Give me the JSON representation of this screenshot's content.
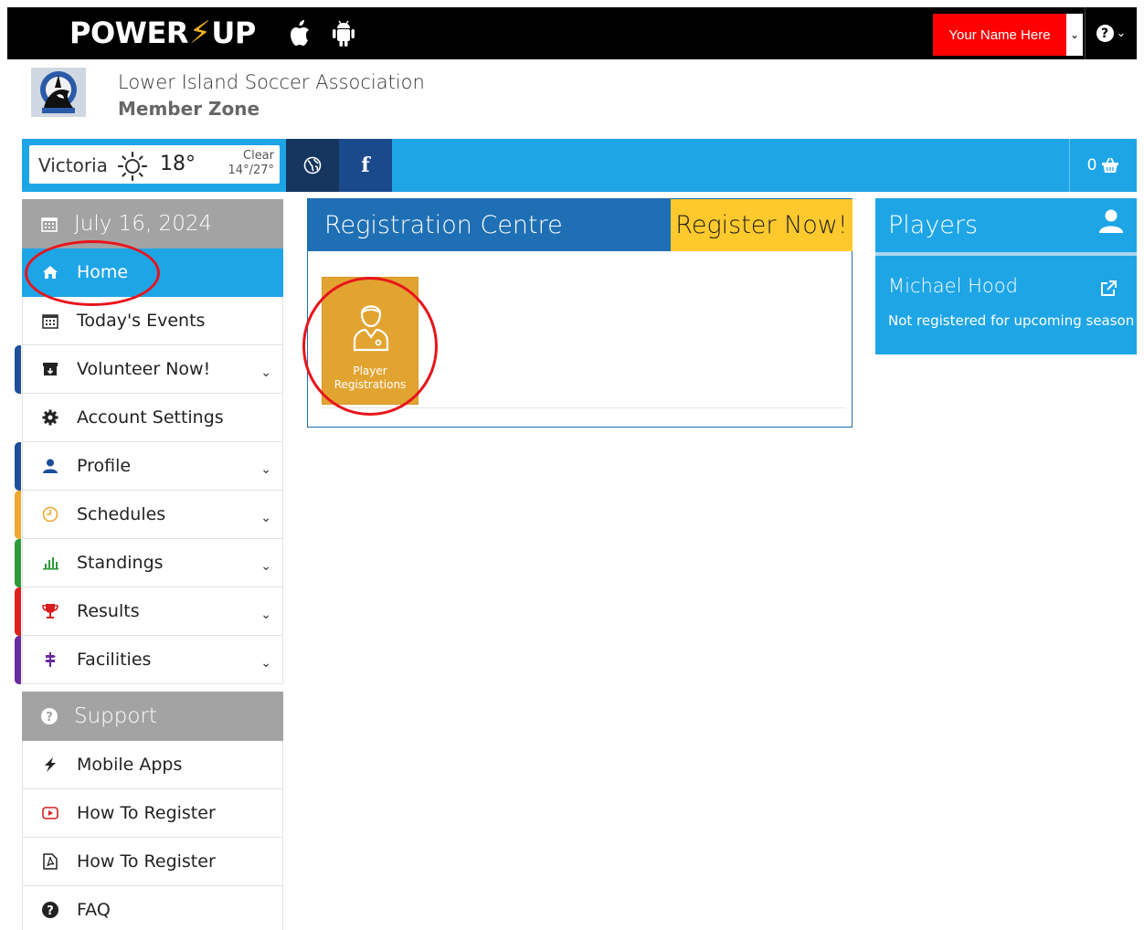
{
  "topbar": {
    "brand_left": "POWER",
    "brand_bolt": "⚡",
    "brand_right": "UP",
    "user_button": "Your Name Here",
    "user_caret": "⌄",
    "help_icon": "?",
    "help_caret": "⌄"
  },
  "header": {
    "org_name": "Lower Island Soccer Association",
    "zone_name": "Member Zone"
  },
  "weather": {
    "city": "Victoria",
    "temp": "18°",
    "condition": "Clear",
    "range": "14°/27°"
  },
  "social": {
    "facebook": "f"
  },
  "cart": {
    "count": "0"
  },
  "sidebar": {
    "date": "July 16, 2024",
    "items": [
      {
        "label": "Home",
        "icon": "home-icon"
      },
      {
        "label": "Today's Events",
        "icon": "calendar-icon"
      },
      {
        "label": "Volunteer Now!",
        "icon": "archive-icon",
        "stripe": "#1c4e9a"
      },
      {
        "label": "Account Settings",
        "icon": "gear-icon"
      },
      {
        "label": "Profile",
        "icon": "user-icon",
        "stripe": "#1c4e9a"
      },
      {
        "label": "Schedules",
        "icon": "clock-icon",
        "stripe": "#f0a830"
      },
      {
        "label": "Standings",
        "icon": "bar-chart-icon",
        "stripe": "#2e9a3a"
      },
      {
        "label": "Results",
        "icon": "trophy-icon",
        "stripe": "#e02020"
      },
      {
        "label": "Facilities",
        "icon": "signpost-icon",
        "stripe": "#6a2aa0"
      }
    ],
    "support_title": "Support",
    "support_items": [
      {
        "label": "Mobile Apps",
        "icon": "bolt-icon"
      },
      {
        "label": "How To Register",
        "icon": "video-icon"
      },
      {
        "label": "How To Register",
        "icon": "pdf-icon"
      },
      {
        "label": "FAQ",
        "icon": "question-icon"
      }
    ]
  },
  "registration": {
    "title": "Registration Centre",
    "register_now": "Register Now!",
    "tile_line1": "Player",
    "tile_line2": "Registrations"
  },
  "players": {
    "title": "Players",
    "name": "Michael Hood",
    "status": "Not registered for upcoming season"
  },
  "colors": {
    "accent_blue": "#1ea5e6",
    "dark_blue": "#1f6fb4",
    "yellow": "#fdc92d",
    "tile_orange": "#e2a431",
    "user_red": "#ff0000",
    "annotation_red": "#e8141b"
  }
}
